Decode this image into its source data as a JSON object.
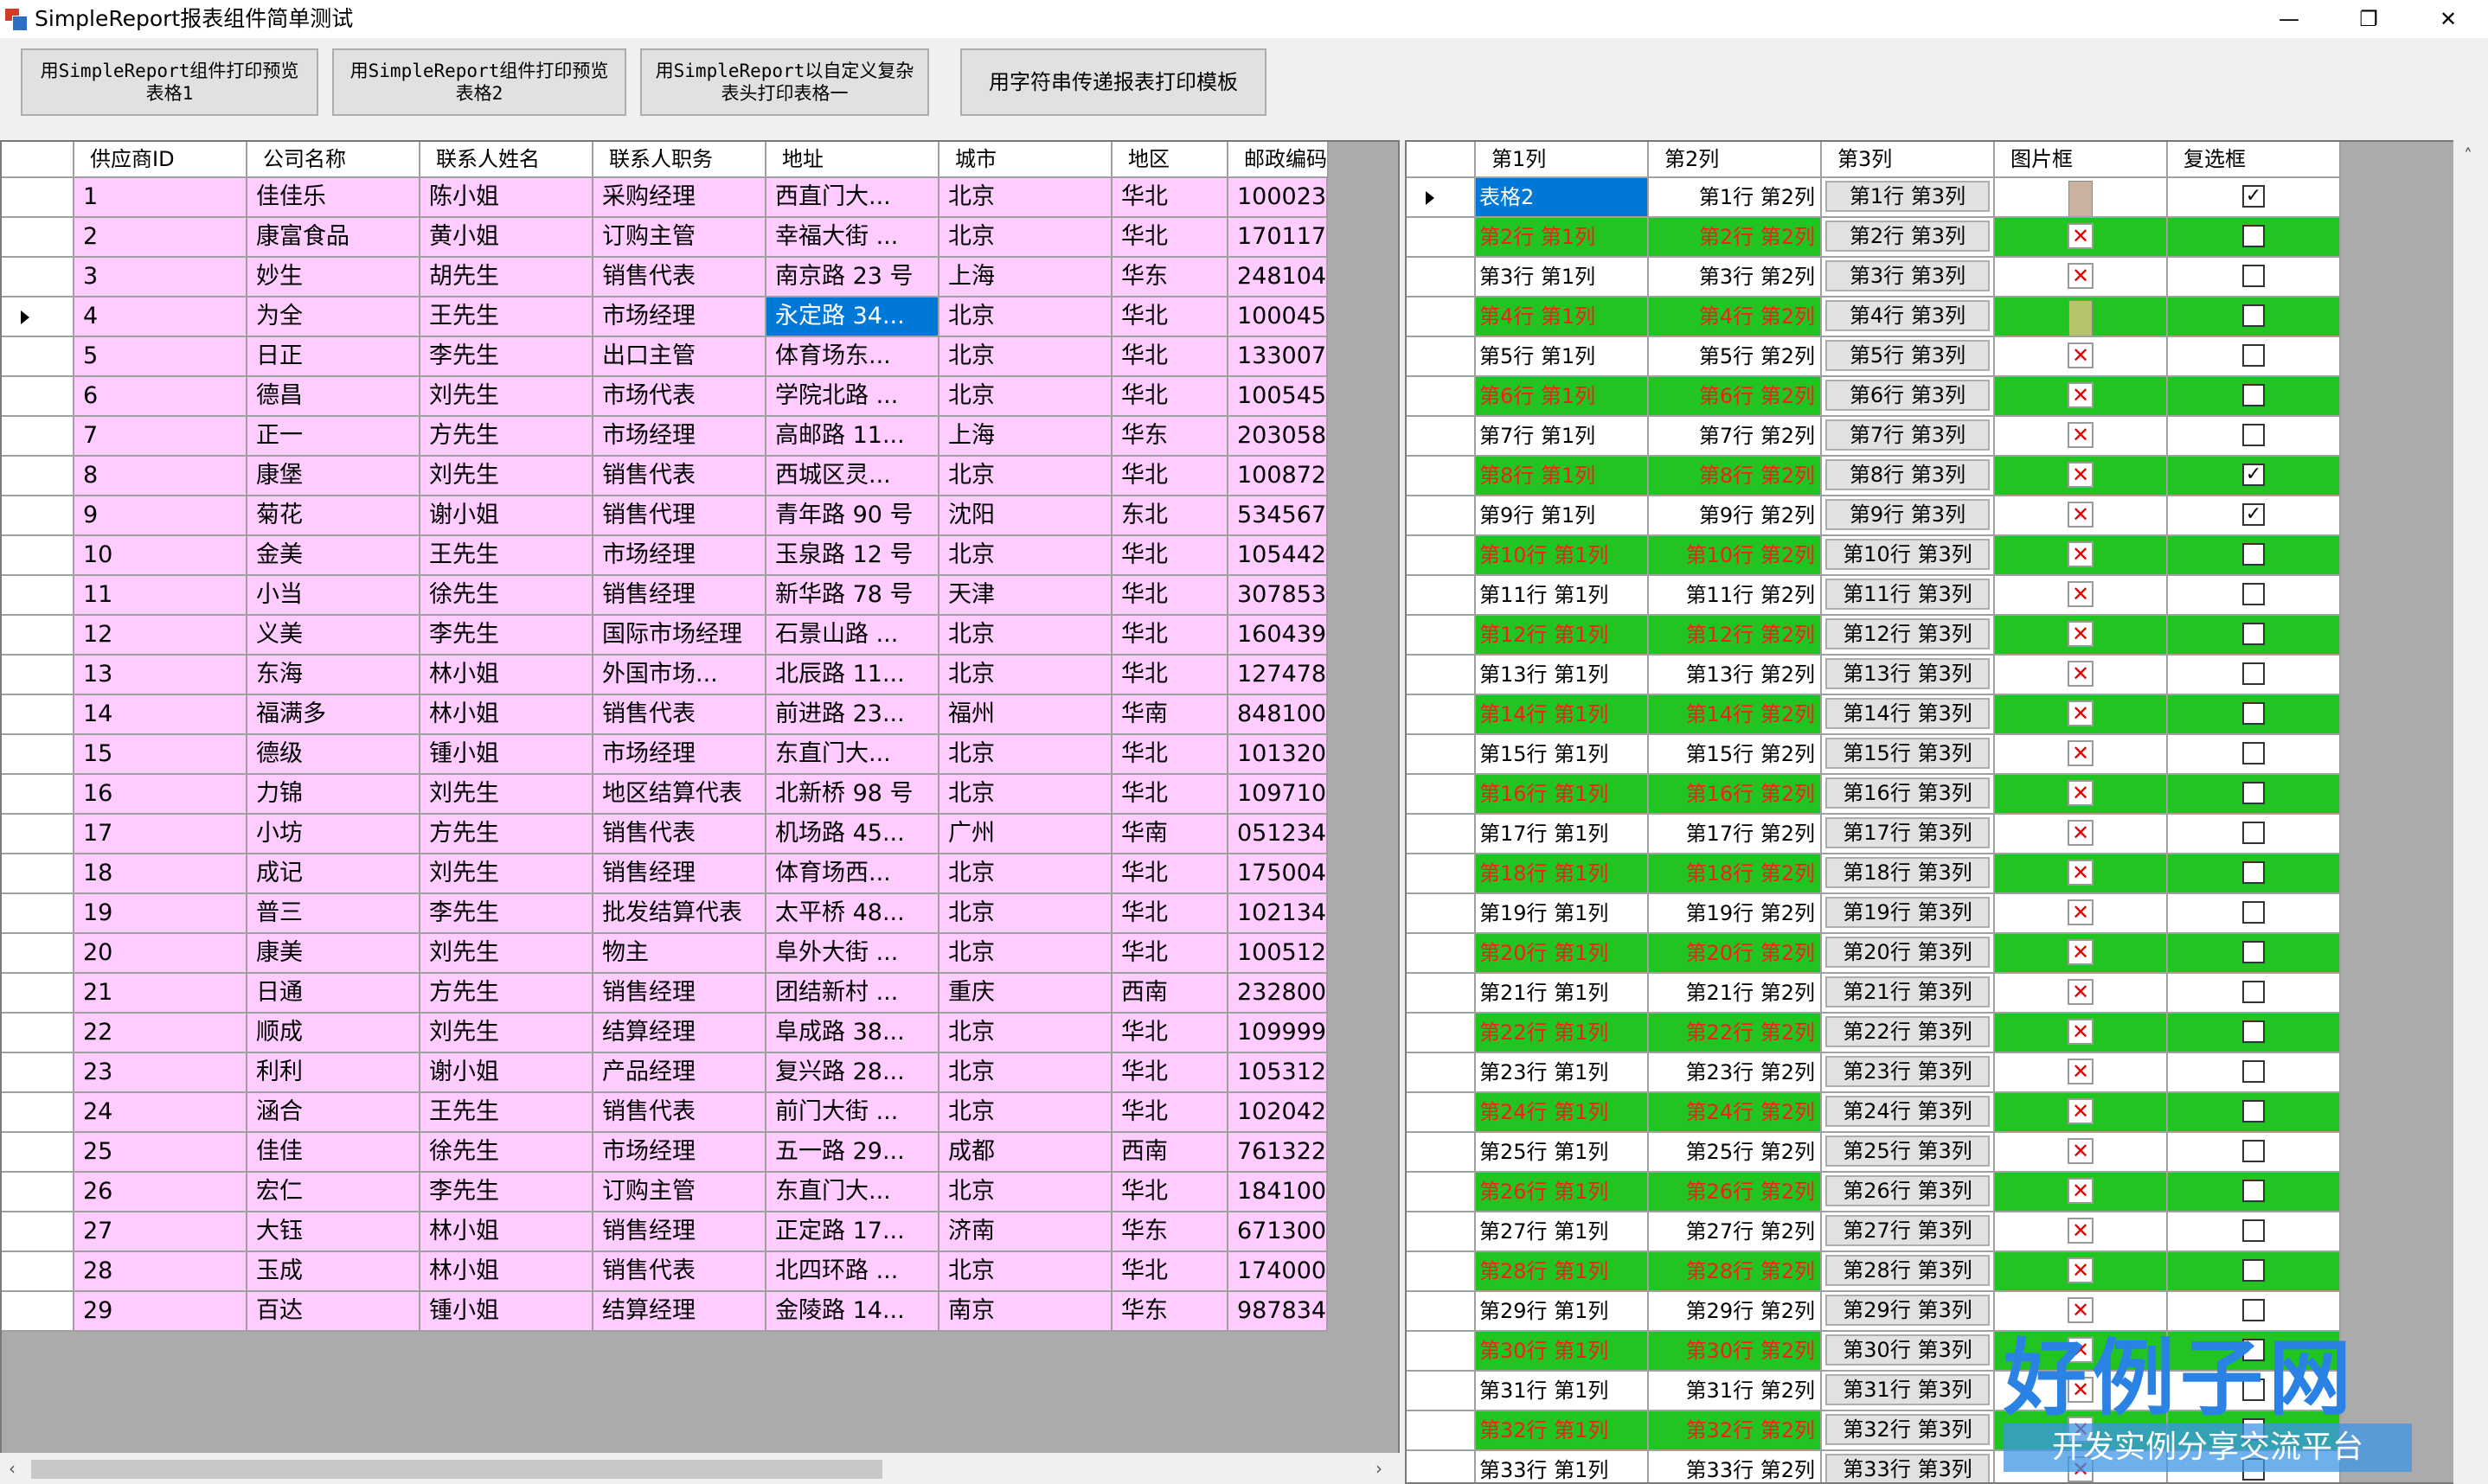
{
  "window": {
    "title": "SimpleReport报表组件简单测试",
    "minimize_glyph": "—",
    "maximize_glyph": "❐",
    "close_glyph": "✕"
  },
  "toolbar": {
    "btn1": "用SimpleReport组件打印预览\n表格1",
    "btn2": "用SimpleReport组件打印预览\n表格2",
    "btn3": "用SimpleReport以自定义复杂\n表头打印表格一",
    "btn4": "用字符串传递报表打印模板"
  },
  "grid1": {
    "columns": [
      "供应商ID",
      "公司名称",
      "联系人姓名",
      "联系人职务",
      "地址",
      "城市",
      "地区",
      "邮政编码"
    ],
    "current_row": 4,
    "selected": {
      "row": 4,
      "col": 4
    },
    "rows": [
      [
        "1",
        "佳佳乐",
        "陈小姐",
        "采购经理",
        "西直门大...",
        "北京",
        "华北",
        "100023"
      ],
      [
        "2",
        "康富食品",
        "黄小姐",
        "订购主管",
        "幸福大街 ...",
        "北京",
        "华北",
        "170117"
      ],
      [
        "3",
        "妙生",
        "胡先生",
        "销售代表",
        "南京路 23 号",
        "上海",
        "华东",
        "248104"
      ],
      [
        "4",
        "为全",
        "王先生",
        "市场经理",
        "永定路 34...",
        "北京",
        "华北",
        "100045"
      ],
      [
        "5",
        "日正",
        "李先生",
        "出口主管",
        "体育场东...",
        "北京",
        "华北",
        "133007"
      ],
      [
        "6",
        "德昌",
        "刘先生",
        "市场代表",
        "学院北路 ...",
        "北京",
        "华北",
        "100545"
      ],
      [
        "7",
        "正一",
        "方先生",
        "市场经理",
        "高邮路 11...",
        "上海",
        "华东",
        "203058"
      ],
      [
        "8",
        "康堡",
        "刘先生",
        "销售代表",
        "西城区灵...",
        "北京",
        "华北",
        "100872"
      ],
      [
        "9",
        "菊花",
        "谢小姐",
        "销售代理",
        "青年路 90 号",
        "沈阳",
        "东北",
        "534567"
      ],
      [
        "10",
        "金美",
        "王先生",
        "市场经理",
        "玉泉路 12 号",
        "北京",
        "华北",
        "105442"
      ],
      [
        "11",
        "小当",
        "徐先生",
        "销售经理",
        "新华路 78 号",
        "天津",
        "华北",
        "307853"
      ],
      [
        "12",
        "义美",
        "李先生",
        "国际市场经理",
        "石景山路 ...",
        "北京",
        "华北",
        "160439"
      ],
      [
        "13",
        "东海",
        "林小姐",
        "外国市场...",
        "北辰路 11...",
        "北京",
        "华北",
        "127478"
      ],
      [
        "14",
        "福满多",
        "林小姐",
        "销售代表",
        "前进路 23...",
        "福州",
        "华南",
        "848100"
      ],
      [
        "15",
        "德级",
        "锺小姐",
        "市场经理",
        "东直门大...",
        "北京",
        "华北",
        "101320"
      ],
      [
        "16",
        "力锦",
        "刘先生",
        "地区结算代表",
        "北新桥 98 号",
        "北京",
        "华北",
        "109710"
      ],
      [
        "17",
        "小坊",
        "方先生",
        "销售代表",
        "机场路 45...",
        "广州",
        "华南",
        "051234"
      ],
      [
        "18",
        "成记",
        "刘先生",
        "销售经理",
        "体育场西...",
        "北京",
        "华北",
        "175004"
      ],
      [
        "19",
        "普三",
        "李先生",
        "批发结算代表",
        "太平桥 48...",
        "北京",
        "华北",
        "102134"
      ],
      [
        "20",
        "康美",
        "刘先生",
        "物主",
        "阜外大街 ...",
        "北京",
        "华北",
        "100512"
      ],
      [
        "21",
        "日通",
        "方先生",
        "销售经理",
        "团结新村 ...",
        "重庆",
        "西南",
        "232800"
      ],
      [
        "22",
        "顺成",
        "刘先生",
        "结算经理",
        "阜成路 38...",
        "北京",
        "华北",
        "109999"
      ],
      [
        "23",
        "利利",
        "谢小姐",
        "产品经理",
        "复兴路 28...",
        "北京",
        "华北",
        "105312"
      ],
      [
        "24",
        "涵合",
        "王先生",
        "销售代表",
        "前门大街 ...",
        "北京",
        "华北",
        "102042"
      ],
      [
        "25",
        "佳佳",
        "徐先生",
        "市场经理",
        "五一路 29...",
        "成都",
        "西南",
        "761322"
      ],
      [
        "26",
        "宏仁",
        "李先生",
        "订购主管",
        "东直门大...",
        "北京",
        "华北",
        "184100"
      ],
      [
        "27",
        "大钰",
        "林小姐",
        "销售经理",
        "正定路 17...",
        "济南",
        "华东",
        "671300"
      ],
      [
        "28",
        "玉成",
        "林小姐",
        "销售代表",
        "北四环路 ...",
        "北京",
        "华北",
        "174000"
      ],
      [
        "29",
        "百达",
        "锺小姐",
        "结算经理",
        "金陵路 14...",
        "南京",
        "华东",
        "987834"
      ]
    ]
  },
  "grid2": {
    "columns": [
      "第1列",
      "第2列",
      "第3列",
      "图片框",
      "复选框"
    ],
    "first_cell": "表格2",
    "checked_rows": [
      1,
      8,
      9
    ],
    "picture_rows": [
      1,
      4
    ],
    "rows": [
      [
        "表格2",
        "第1行 第2列",
        "第1行 第3列"
      ],
      [
        "第2行 第1列",
        "第2行 第2列",
        "第2行 第3列"
      ],
      [
        "第3行 第1列",
        "第3行 第2列",
        "第3行 第3列"
      ],
      [
        "第4行 第1列",
        "第4行 第2列",
        "第4行 第3列"
      ],
      [
        "第5行 第1列",
        "第5行 第2列",
        "第5行 第3列"
      ],
      [
        "第6行 第1列",
        "第6行 第2列",
        "第6行 第3列"
      ],
      [
        "第7行 第1列",
        "第7行 第2列",
        "第7行 第3列"
      ],
      [
        "第8行 第1列",
        "第8行 第2列",
        "第8行 第3列"
      ],
      [
        "第9行 第1列",
        "第9行 第2列",
        "第9行 第3列"
      ],
      [
        "第10行 第1列",
        "第10行 第2列",
        "第10行 第3列"
      ],
      [
        "第11行 第1列",
        "第11行 第2列",
        "第11行 第3列"
      ],
      [
        "第12行 第1列",
        "第12行 第2列",
        "第12行 第3列"
      ],
      [
        "第13行 第1列",
        "第13行 第2列",
        "第13行 第3列"
      ],
      [
        "第14行 第1列",
        "第14行 第2列",
        "第14行 第3列"
      ],
      [
        "第15行 第1列",
        "第15行 第2列",
        "第15行 第3列"
      ],
      [
        "第16行 第1列",
        "第16行 第2列",
        "第16行 第3列"
      ],
      [
        "第17行 第1列",
        "第17行 第2列",
        "第17行 第3列"
      ],
      [
        "第18行 第1列",
        "第18行 第2列",
        "第18行 第3列"
      ],
      [
        "第19行 第1列",
        "第19行 第2列",
        "第19行 第3列"
      ],
      [
        "第20行 第1列",
        "第20行 第2列",
        "第20行 第3列"
      ],
      [
        "第21行 第1列",
        "第21行 第2列",
        "第21行 第3列"
      ],
      [
        "第22行 第1列",
        "第22行 第2列",
        "第22行 第3列"
      ],
      [
        "第23行 第1列",
        "第23行 第2列",
        "第23行 第3列"
      ],
      [
        "第24行 第1列",
        "第24行 第2列",
        "第24行 第3列"
      ],
      [
        "第25行 第1列",
        "第25行 第2列",
        "第25行 第3列"
      ],
      [
        "第26行 第1列",
        "第26行 第2列",
        "第26行 第3列"
      ],
      [
        "第27行 第1列",
        "第27行 第2列",
        "第27行 第3列"
      ],
      [
        "第28行 第1列",
        "第28行 第2列",
        "第28行 第3列"
      ],
      [
        "第29行 第1列",
        "第29行 第2列",
        "第29行 第3列"
      ],
      [
        "第30行 第1列",
        "第30行 第2列",
        "第30行 第3列"
      ],
      [
        "第31行 第1列",
        "第31行 第2列",
        "第31行 第3列"
      ],
      [
        "第32行 第1列",
        "第32行 第2列",
        "第32行 第3列"
      ],
      [
        "第33行 第1列",
        "第33行 第2列",
        "第33行 第3列"
      ]
    ]
  },
  "watermark": {
    "brand": "好例子网",
    "slogan": "开发实例分享交流平台"
  },
  "colors": {
    "pink_row": "#ffccff",
    "green_row": "#22c422",
    "red_text": "#ff1a1a",
    "selection": "#0078d7"
  },
  "icons": {
    "row_pointer": "row-pointer-icon",
    "broken_image": "broken-image-icon",
    "checkbox": "checkbox-icon"
  }
}
